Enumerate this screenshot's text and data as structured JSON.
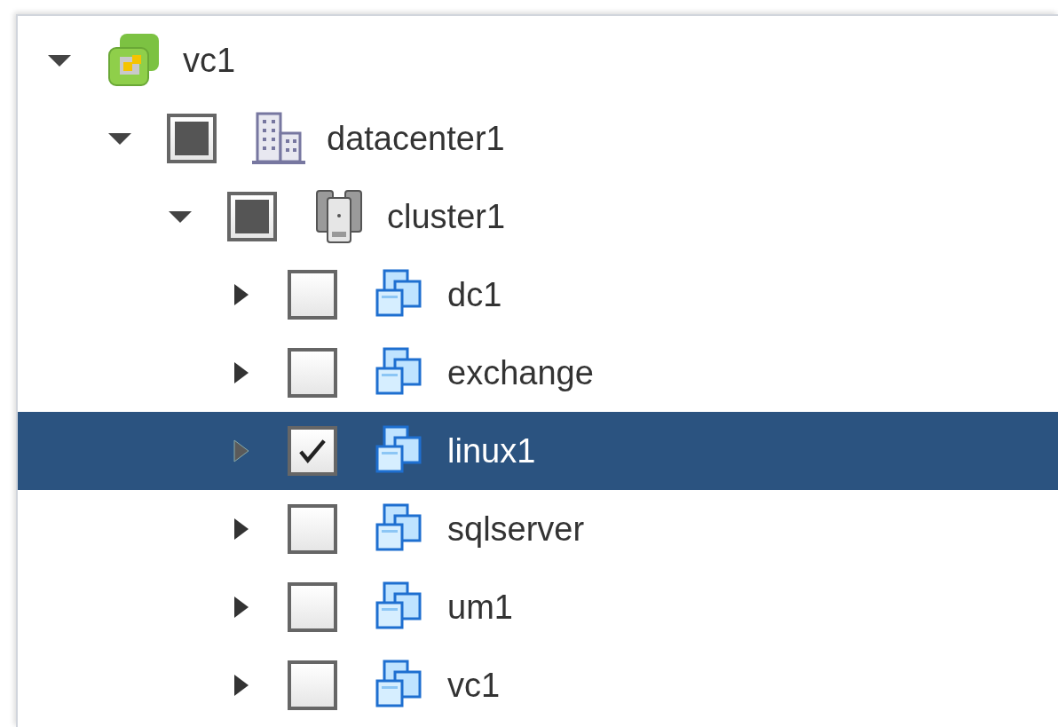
{
  "tree": [
    {
      "label": "vc1",
      "kind": "vcenter",
      "expanded": true,
      "selected": false,
      "children": [
        {
          "label": "datacenter1",
          "kind": "datacenter",
          "expanded": true,
          "selected": false,
          "checked": false,
          "indeterminate": true,
          "children": [
            {
              "label": "cluster1",
              "kind": "cluster",
              "expanded": true,
              "selected": false,
              "checked": false,
              "indeterminate": true,
              "children": [
                {
                  "label": "dc1",
                  "kind": "vm",
                  "expanded": false,
                  "selected": false,
                  "checked": false,
                  "indeterminate": false
                },
                {
                  "label": "exchange",
                  "kind": "vm",
                  "expanded": false,
                  "selected": false,
                  "checked": false,
                  "indeterminate": false
                },
                {
                  "label": "linux1",
                  "kind": "vm",
                  "expanded": false,
                  "selected": true,
                  "checked": true,
                  "indeterminate": false
                },
                {
                  "label": "sqlserver",
                  "kind": "vm",
                  "expanded": false,
                  "selected": false,
                  "checked": false,
                  "indeterminate": false
                },
                {
                  "label": "um1",
                  "kind": "vm",
                  "expanded": false,
                  "selected": false,
                  "checked": false,
                  "indeterminate": false
                },
                {
                  "label": "vc1",
                  "kind": "vm",
                  "expanded": false,
                  "selected": false,
                  "checked": false,
                  "indeterminate": false
                }
              ]
            }
          ]
        }
      ]
    }
  ]
}
